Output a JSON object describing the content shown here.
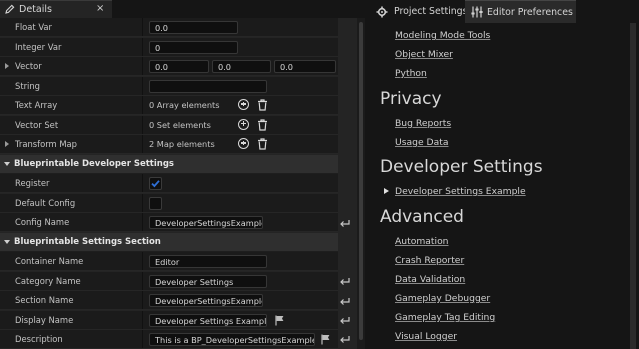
{
  "details": {
    "tab_title": "Details",
    "close_glyph": "×",
    "properties": [
      {
        "name": "Float Var",
        "value": "0.0"
      },
      {
        "name": "Integer Var",
        "value": "0"
      },
      {
        "name": "Vector",
        "x": "0.0",
        "y": "0.0",
        "z": "0.0"
      },
      {
        "name": "String",
        "value": ""
      },
      {
        "name": "Text Array",
        "value": "0 Array elements"
      },
      {
        "name": "Vector Set",
        "value": "0 Set elements"
      },
      {
        "name": "Transform Map",
        "value": "2 Map elements"
      }
    ],
    "developer_section": {
      "title": "Blueprintable Developer Settings",
      "register_label": "Register",
      "register_checked": true,
      "default_config_label": "Default Config",
      "default_config_checked": false,
      "config_name_label": "Config Name",
      "config_name_value": "DeveloperSettingsExample"
    },
    "settings_section": {
      "title": "Blueprintable Settings Section",
      "container_name_label": "Container Name",
      "container_name_value": "Editor",
      "category_name_label": "Category Name",
      "category_name_value": "Developer Settings",
      "section_name_label": "Section Name",
      "section_name_value": "DeveloperSettingsExample",
      "display_name_label": "Display Name",
      "display_name_value": "Developer Settings Example",
      "description_label": "Description",
      "description_value": "This is a BP_DeveloperSettingsExample c"
    }
  },
  "prefs": {
    "tabs": [
      "Project Settings",
      "Editor Preferences"
    ],
    "active_tab": "Editor Preferences",
    "top_links": [
      "Modeling Mode Tools",
      "Object Mixer",
      "Python"
    ],
    "privacy": {
      "heading": "Privacy",
      "links": [
        "Bug Reports",
        "Usage Data"
      ]
    },
    "developer": {
      "heading": "Developer Settings",
      "links": [
        "Developer Settings Example"
      ]
    },
    "advanced": {
      "heading": "Advanced",
      "links": [
        "Automation",
        "Crash Reporter",
        "Data Validation",
        "Gameplay Debugger",
        "Gameplay Tag Editing",
        "Visual Logger"
      ]
    }
  },
  "colors": {
    "accent_check": "#2f6fd6",
    "panel_bg": "#242424",
    "category_bg": "#2f2f2f",
    "window_bg": "#151515"
  }
}
